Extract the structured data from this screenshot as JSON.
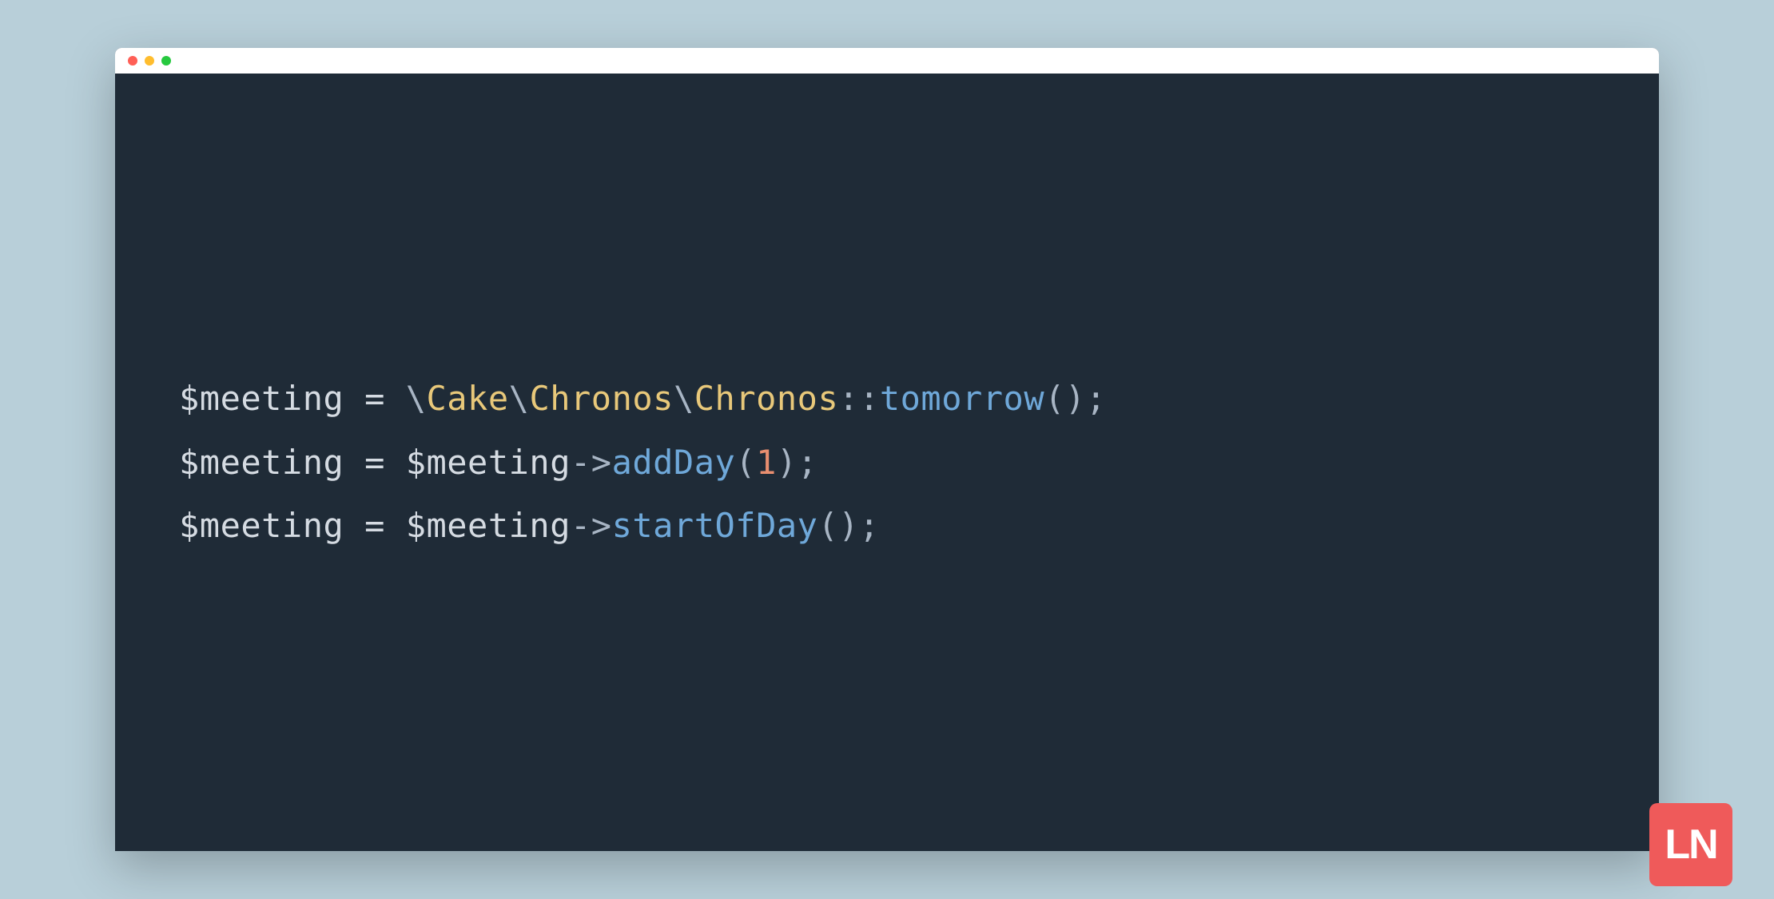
{
  "colors": {
    "background": "#b8cfd9",
    "editor_bg": "#1f2b37",
    "titlebar_bg": "#ffffff",
    "traffic_close": "#ff5f56",
    "traffic_min": "#ffbd2e",
    "traffic_max": "#27c93f",
    "logo_bg": "#ef5a5a",
    "token_var": "#d5dbe2",
    "token_ns": "#e8c87a",
    "token_method": "#6fa8d9",
    "token_num": "#e88e6f",
    "token_punct": "#a8b5c4"
  },
  "logo": {
    "text": "LN"
  },
  "code": {
    "line1": {
      "var": "$meeting",
      "sp1": " ",
      "eq": "=",
      "sp2": " ",
      "bs1": "\\",
      "ns1": "Cake",
      "bs2": "\\",
      "ns2": "Chronos",
      "bs3": "\\",
      "ns3": "Chronos",
      "scope": "::",
      "method": "tomorrow",
      "paren": "()",
      "semi": ";"
    },
    "line2": {
      "var": "$meeting",
      "sp1": " ",
      "eq": "=",
      "sp2": " ",
      "var2": "$meeting",
      "arrow": "->",
      "method": "addDay",
      "lparen": "(",
      "arg": "1",
      "rparen": ")",
      "semi": ";"
    },
    "line3": {
      "var": "$meeting",
      "sp1": " ",
      "eq": "=",
      "sp2": " ",
      "var2": "$meeting",
      "arrow": "->",
      "method": "startOfDay",
      "paren": "()",
      "semi": ";"
    }
  }
}
